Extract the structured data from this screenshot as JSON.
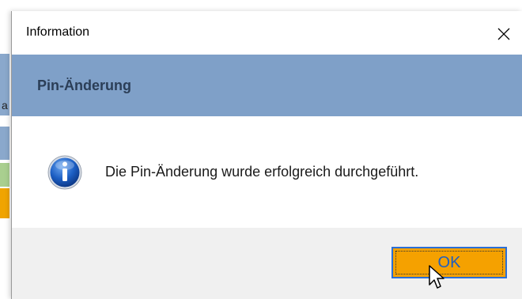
{
  "background": {
    "partial_text": "a"
  },
  "dialog": {
    "title": "Information",
    "close_icon": "close-icon",
    "header": "Pin-Änderung",
    "icon": "info-icon",
    "message": "Die Pin-Änderung wurde erfolgreich durchgeführt.",
    "ok_label": "OK"
  },
  "colors": {
    "header_band": "#7fa0c8",
    "header_text": "#2b3e57",
    "ok_button": "#f5a100",
    "ok_text": "#1f5fbf",
    "footer": "#f0f0f0"
  }
}
